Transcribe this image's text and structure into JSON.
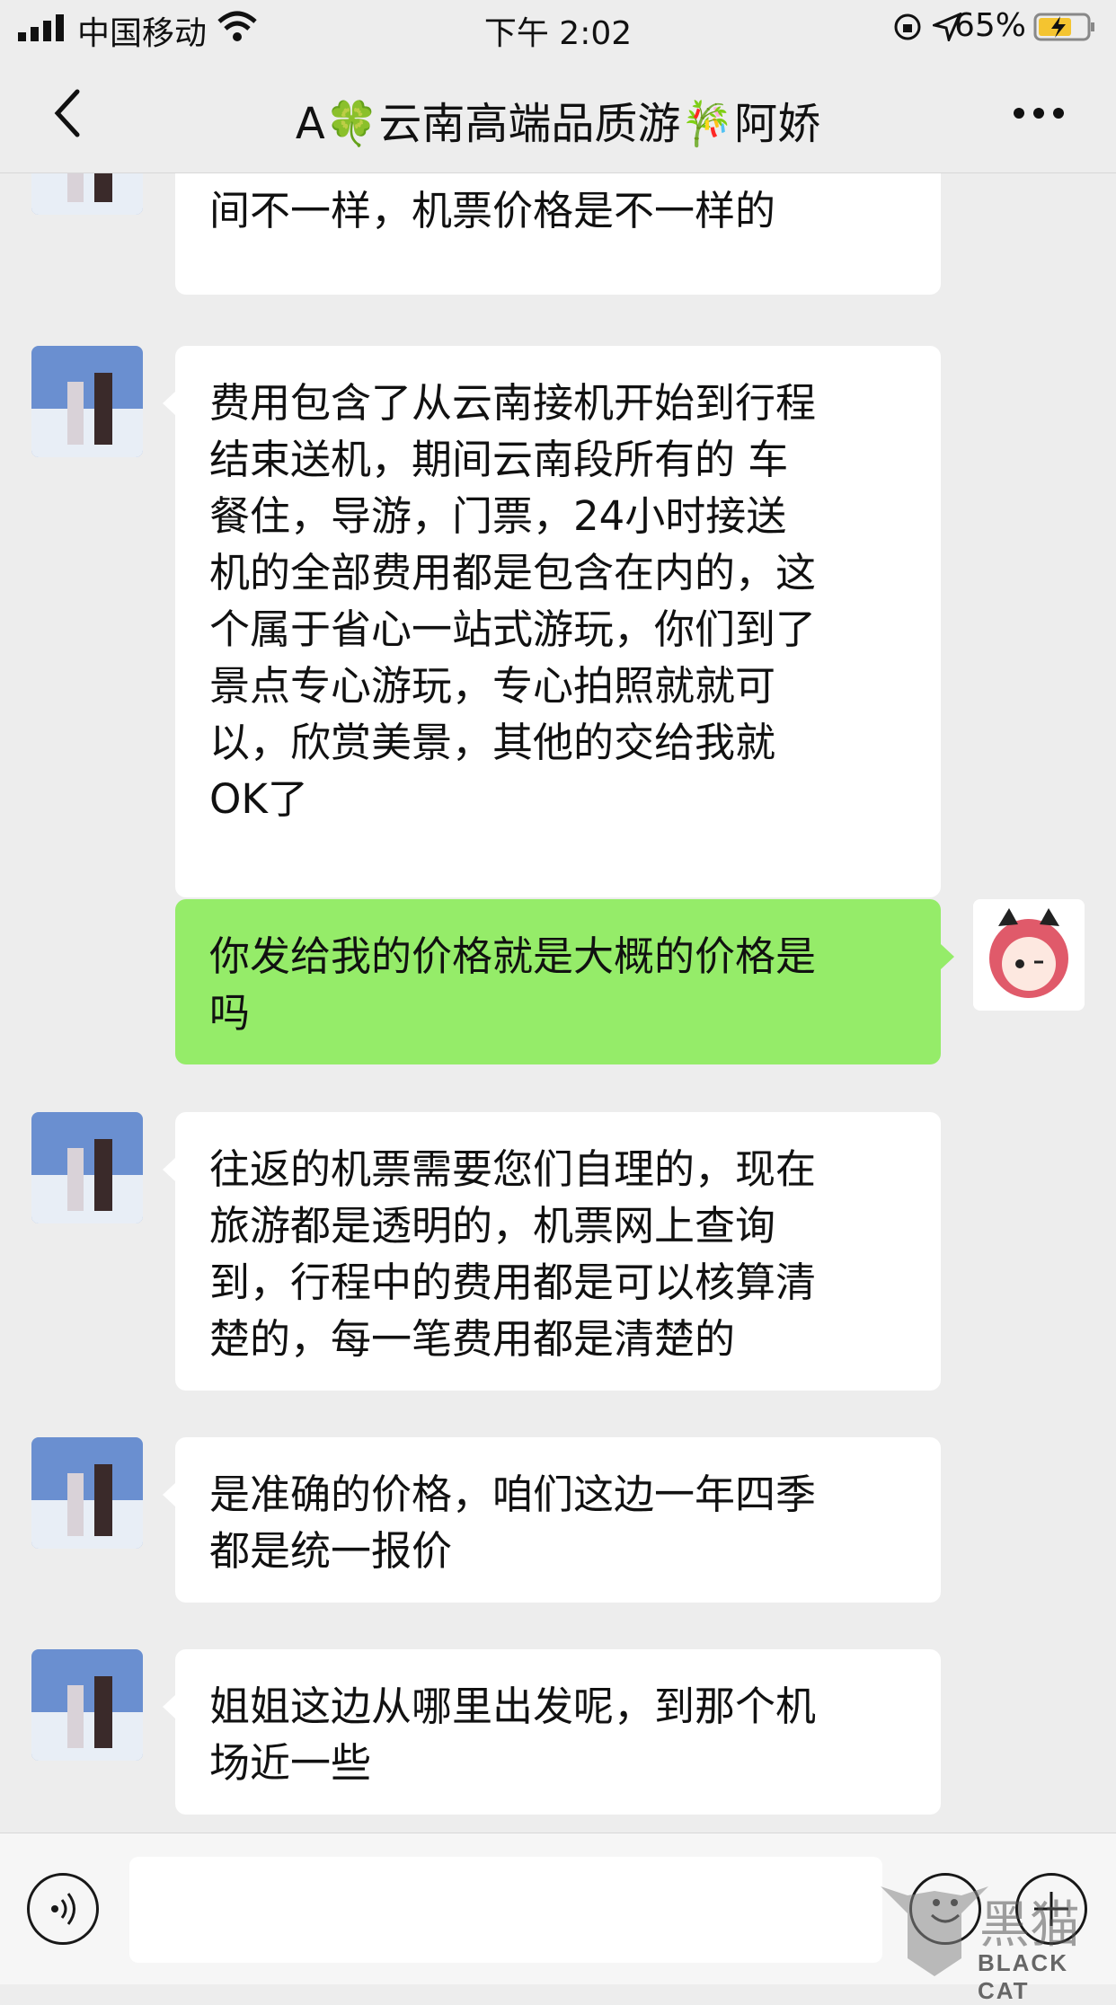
{
  "status_bar": {
    "carrier": "中国移动",
    "time": "下午 2:02",
    "battery_percent": "65%"
  },
  "nav": {
    "title": "A🍀云南高端品质游🎋阿娇"
  },
  "messages": [
    {
      "sender": "agent",
      "text": "姐姐，出发的时间不一样，航班时\n间不一样，机票价格是不一样的"
    },
    {
      "sender": "agent",
      "text": "费用包含了从云南接机开始到行程\n结束送机，期间云南段所有的 车\n餐住，导游，门票，24小时接送\n机的全部费用都是包含在内的，这\n个属于省心一站式游玩，你们到了\n景点专心游玩，专心拍照就就可\n以，欣赏美景，其他的交给我就\nOK了"
    },
    {
      "sender": "me",
      "text": "你发给我的价格就是大概的价格是\n吗"
    },
    {
      "sender": "agent",
      "text": "往返的机票需要您们自理的，现在\n旅游都是透明的，机票网上查询\n到，行程中的费用都是可以核算清\n楚的，每一笔费用都是清楚的"
    },
    {
      "sender": "agent",
      "text": "是准确的价格，咱们这边一年四季\n都是统一报价"
    },
    {
      "sender": "agent",
      "text": "姐姐这边从哪里出发呢，到那个机\n场近一些"
    }
  ],
  "input": {
    "value": ""
  },
  "watermark": {
    "text": "BLACK CAT",
    "mark": "黑猫"
  },
  "colors": {
    "self_bubble": "#95ec69",
    "other_bubble": "#ffffff",
    "background": "#ededed"
  }
}
